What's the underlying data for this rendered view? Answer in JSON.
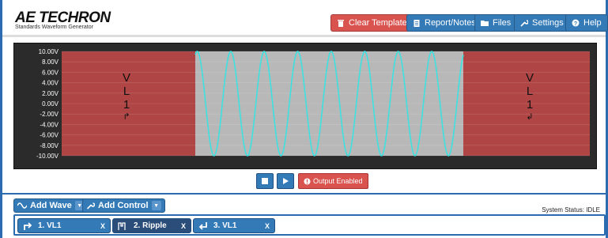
{
  "app": {
    "logo": "AE TECHRON",
    "subtitle": "Standards Waveform Generator"
  },
  "header": {
    "buttons": [
      {
        "label": "Clear Template",
        "icon": "trash-icon"
      },
      {
        "label": "Report/Notes",
        "icon": "clipboard-icon"
      },
      {
        "label": "Files",
        "icon": "folder-icon"
      },
      {
        "label": "Settings",
        "icon": "wrench-icon"
      },
      {
        "label": "Help",
        "icon": "question-icon"
      }
    ]
  },
  "scope": {
    "y_ticks": [
      "10.00V",
      "8.00V",
      "6.00V",
      "4.00V",
      "2.00V",
      "0.00V",
      "-2.00V",
      "-4.00V",
      "-6.00V",
      "-8.00V",
      "-10.00V"
    ],
    "left_segment": {
      "letters": [
        "V",
        "L",
        "1"
      ],
      "arrow": "↱"
    },
    "right_segment": {
      "letters": [
        "V",
        "L",
        "1"
      ],
      "arrow": "↲"
    },
    "wave_cycles": 8,
    "wave_amplitude_v": 10,
    "colors": {
      "hold": "#b04545",
      "ripple_bg": "#b8b8b8",
      "wave": "#3fe0e0",
      "text": "#ffffff"
    }
  },
  "controls": {
    "stop_icon": "stop-icon",
    "play_icon": "play-icon",
    "output_label": "Output Enabled",
    "output_icon": "alert-icon"
  },
  "toolbar": {
    "add_wave": "Add Wave",
    "add_control": "Add Control",
    "status": "System Status: IDLE"
  },
  "track": {
    "items": [
      {
        "label": "1. VL1",
        "close": "X",
        "icon": "step-up-icon"
      },
      {
        "label": "2. Ripple",
        "close": "X",
        "icon": "ripple-icon"
      },
      {
        "label": "3. VL1",
        "close": "X",
        "icon": "step-down-icon"
      }
    ]
  }
}
